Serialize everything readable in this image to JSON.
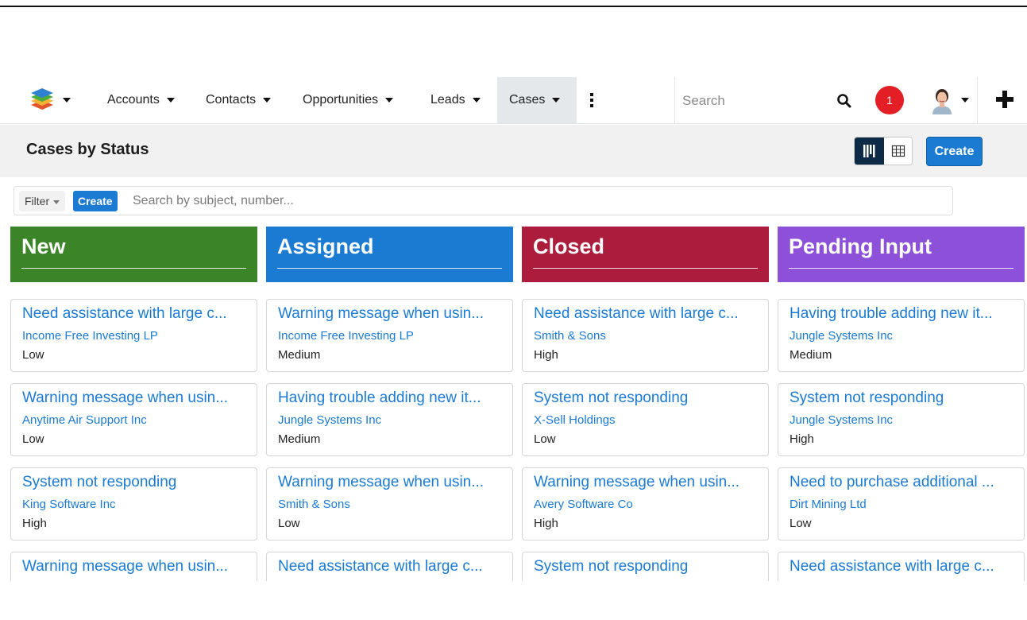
{
  "nav": {
    "items": [
      {
        "label": "Accounts"
      },
      {
        "label": "Contacts"
      },
      {
        "label": "Opportunities"
      },
      {
        "label": "Leads"
      },
      {
        "label": "Cases"
      }
    ],
    "active": "Cases",
    "search_placeholder": "Search",
    "notification_count": "1"
  },
  "page": {
    "title": "Cases by Status",
    "create_label": "Create",
    "view_mode": "kanban"
  },
  "filter": {
    "filter_label": "Filter",
    "create_label": "Create",
    "search_placeholder": "Search by subject, number..."
  },
  "colors": {
    "new": "#3b8427",
    "assigned": "#1b7ad2",
    "closed": "#ac1c3c",
    "pending": "#8c50d9",
    "accent": "#1b7ad2"
  },
  "columns": [
    {
      "title": "New",
      "cards": [
        {
          "subject": "Need assistance with large c...",
          "account": "Income Free Investing LP",
          "priority": "Low"
        },
        {
          "subject": "Warning message when usin...",
          "account": "Anytime Air Support Inc",
          "priority": "Low"
        },
        {
          "subject": "System not responding",
          "account": "King Software Inc",
          "priority": "High"
        },
        {
          "subject": "Warning message when usin...",
          "account": "",
          "priority": ""
        }
      ]
    },
    {
      "title": "Assigned",
      "cards": [
        {
          "subject": "Warning message when usin...",
          "account": "Income Free Investing LP",
          "priority": "Medium"
        },
        {
          "subject": "Having trouble adding new it...",
          "account": "Jungle Systems Inc",
          "priority": "Medium"
        },
        {
          "subject": "Warning message when usin...",
          "account": "Smith & Sons",
          "priority": "Low"
        },
        {
          "subject": "Need assistance with large c...",
          "account": "",
          "priority": ""
        }
      ]
    },
    {
      "title": "Closed",
      "cards": [
        {
          "subject": "Need assistance with large c...",
          "account": "Smith & Sons",
          "priority": "High"
        },
        {
          "subject": "System not responding",
          "account": "X-Sell Holdings",
          "priority": "Low"
        },
        {
          "subject": "Warning message when usin...",
          "account": "Avery Software Co",
          "priority": "High"
        },
        {
          "subject": "System not responding",
          "account": "",
          "priority": ""
        }
      ]
    },
    {
      "title": "Pending Input",
      "cards": [
        {
          "subject": "Having trouble adding new it...",
          "account": "Jungle Systems Inc",
          "priority": "Medium"
        },
        {
          "subject": "System not responding",
          "account": "Jungle Systems Inc",
          "priority": "High"
        },
        {
          "subject": "Need to purchase additional ...",
          "account": "Dirt Mining Ltd",
          "priority": "Low"
        },
        {
          "subject": "Need assistance with large c...",
          "account": "",
          "priority": ""
        }
      ]
    }
  ]
}
